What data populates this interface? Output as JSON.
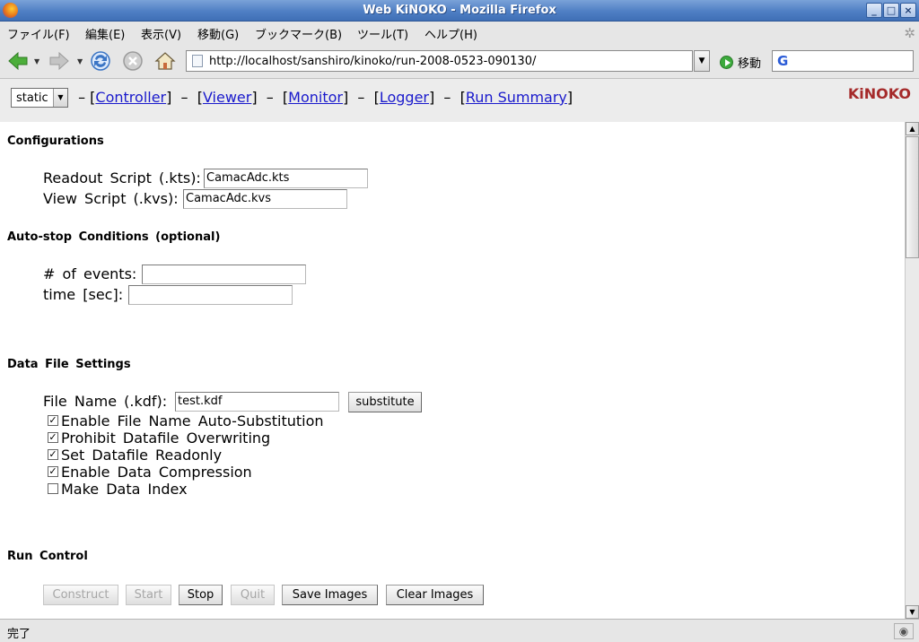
{
  "window": {
    "title": "Web KiNOKO - Mozilla Firefox"
  },
  "menu": [
    "ファイル(F)",
    "編集(E)",
    "表示(V)",
    "移動(G)",
    "ブックマーク(B)",
    "ツール(T)",
    "ヘルプ(H)"
  ],
  "toolbar": {
    "url": "http://localhost/sanshiro/kinoko/run-2008-0523-090130/",
    "go_label": "移動"
  },
  "page": {
    "mode_select": "static",
    "nav": [
      "Controller",
      "Viewer",
      "Monitor",
      "Logger",
      "Run Summary"
    ],
    "brand": "KiNOKO",
    "configurations": {
      "title": "Configurations",
      "readout_label": "Readout Script (.kts):",
      "readout_value": "CamacAdc.kts",
      "view_label": "View Script (.kvs):",
      "view_value": "CamacAdc.kvs"
    },
    "autostop": {
      "title": "Auto-stop Conditions (optional)",
      "events_label": "# of events:",
      "events_value": "",
      "time_label": "time [sec]:",
      "time_value": ""
    },
    "datafile": {
      "title": "Data File Settings",
      "filename_label": "File Name (.kdf):",
      "filename_value": "test.kdf",
      "substitute_label": "substitute",
      "options": [
        {
          "label": "Enable File Name Auto-Substitution",
          "checked": true
        },
        {
          "label": "Prohibit Datafile Overwriting",
          "checked": true
        },
        {
          "label": "Set Datafile Readonly",
          "checked": true
        },
        {
          "label": "Enable Data Compression",
          "checked": true
        },
        {
          "label": "Make Data Index",
          "checked": false
        }
      ]
    },
    "runcontrol": {
      "title": "Run Control",
      "buttons": [
        {
          "label": "Construct",
          "enabled": false
        },
        {
          "label": "Start",
          "enabled": false
        },
        {
          "label": "Stop",
          "enabled": true
        },
        {
          "label": "Quit",
          "enabled": false
        },
        {
          "label": "Save Images",
          "enabled": true
        },
        {
          "label": "Clear Images",
          "enabled": true
        }
      ]
    }
  },
  "status": {
    "text": "完了"
  }
}
